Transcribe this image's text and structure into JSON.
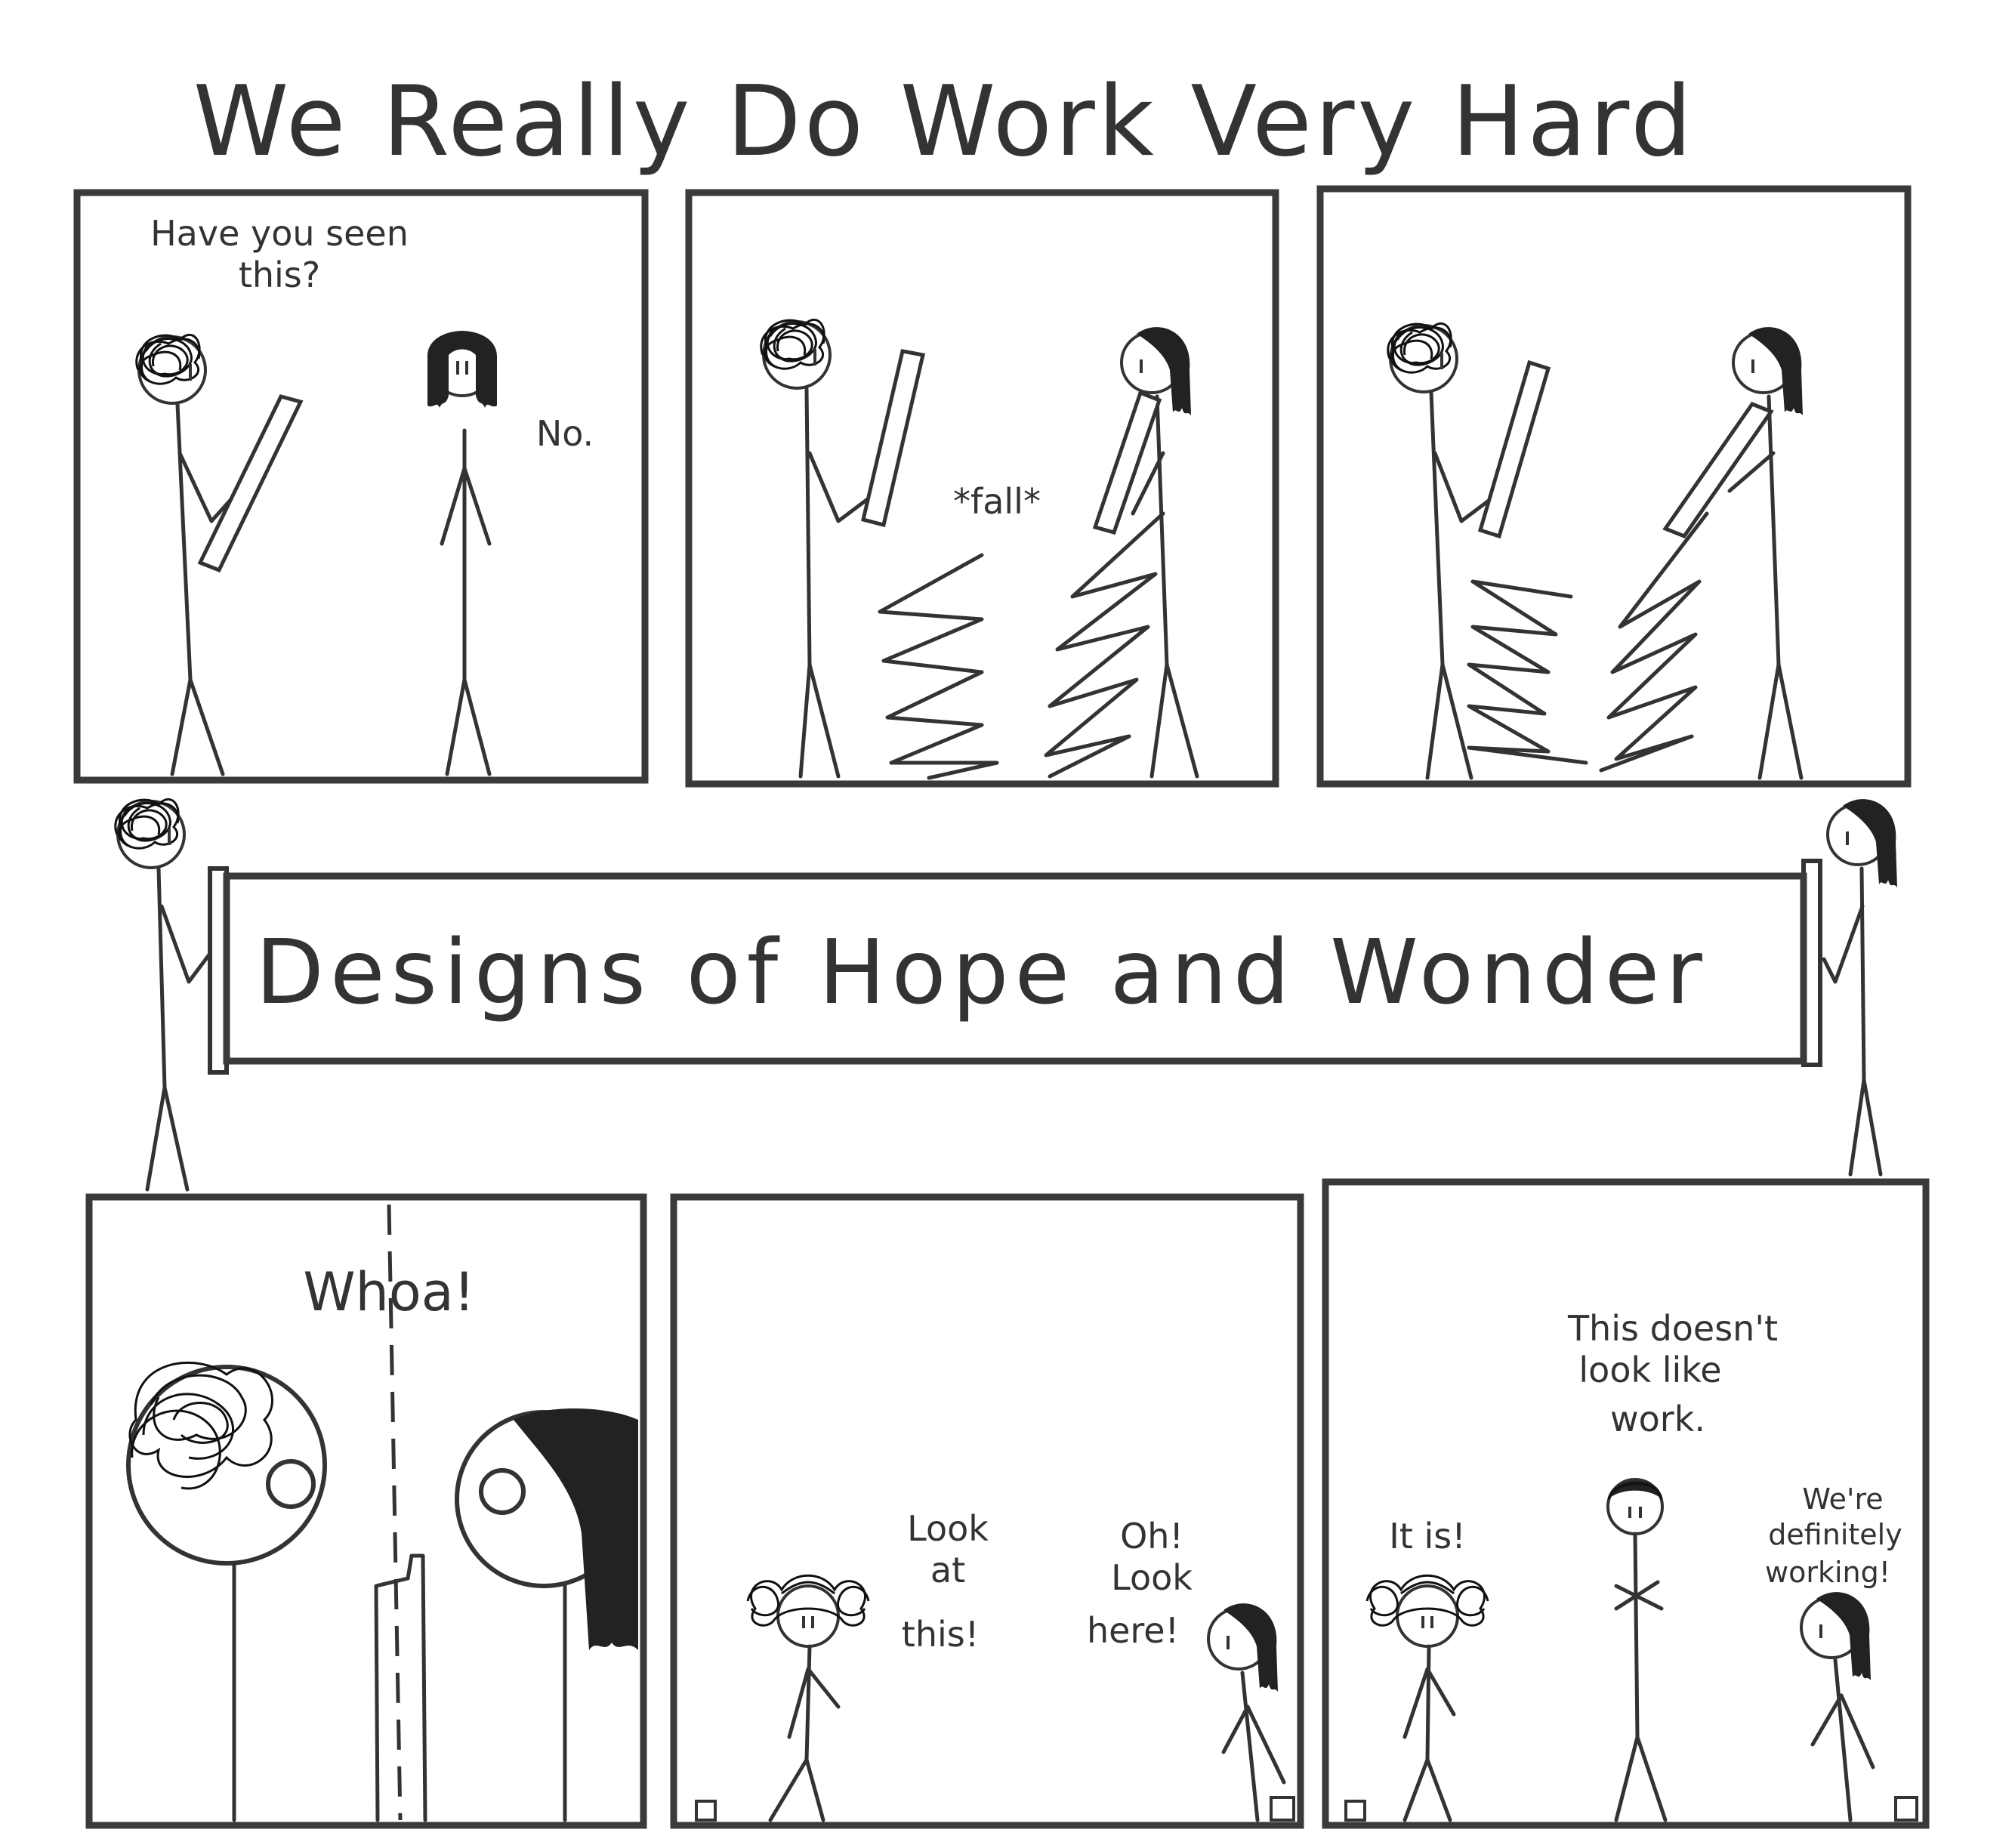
{
  "comic": {
    "title": "We Really Do Work Very Hard",
    "banner": "Designs of Hope and Wonder",
    "panel1": {
      "speech_a_line1": "Have you seen",
      "speech_a_line2": "this?",
      "speech_b": "No."
    },
    "panel2": {
      "sound": "*fall*"
    },
    "panel4": {
      "speech": "Whoa!"
    },
    "panel5": {
      "speech_a_line1": "Look",
      "speech_a_line2": "at",
      "speech_a_line3": "this!",
      "speech_b_line1": "Oh!",
      "speech_b_line2": "Look",
      "speech_b_line3": "here!"
    },
    "panel6": {
      "speech_boss_line1": "This doesn't",
      "speech_boss_line2": "look like",
      "speech_boss_line3": "work.",
      "speech_a": "It is!",
      "speech_b_line1": "We're",
      "speech_b_line2": "definitely",
      "speech_b_line3": "working!"
    }
  }
}
